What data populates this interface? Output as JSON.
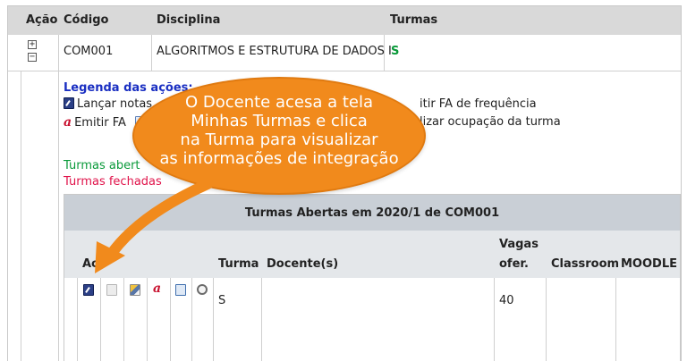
{
  "table": {
    "headers": {
      "acao": "Ação",
      "codigo": "Código",
      "disciplina": "Disciplina",
      "turmas": "Turmas"
    },
    "row": {
      "codigo": "COM001",
      "disciplina": "ALGORITMOS E ESTRUTURA DE DADOS I",
      "turmas": "S"
    },
    "expand_plus": "+",
    "expand_minus": "−"
  },
  "legend": {
    "title": "Legenda das ações:",
    "items": [
      {
        "icon": "edit-icon",
        "label": "Lançar notas"
      },
      {
        "icon": "fa-icon",
        "label": "Emitir FA"
      },
      {
        "icon": "document-icon",
        "label": ""
      },
      {
        "label": "itir FA de frequência"
      },
      {
        "label": "lizar ocupação da turma"
      }
    ]
  },
  "status": {
    "open_label": "Turmas abert",
    "closed_label": "Turmas fechadas",
    "open_color": "#0a9a3a",
    "closed_color": "#e0134a"
  },
  "inner_table": {
    "title": "Turmas Abertas em 2020/1 de COM001",
    "headers": {
      "acoes": "Ac",
      "turma": "Turma",
      "docente": "Docente(s)",
      "vagas_line1": "Vagas",
      "vagas_line2": "ofer.",
      "classroom": "Classroom",
      "moodle": "MOODLE"
    },
    "row": {
      "turma": "S",
      "docente": "",
      "vagas": "40",
      "classroom": "",
      "moodle": ""
    },
    "action_icons": [
      "edit-icon",
      "report-icon",
      "pencil-icon",
      "fa-icon",
      "clipboard-icon",
      "search-icon"
    ]
  },
  "callout": {
    "lines": [
      "O Docente acesa a tela",
      "Minhas Turmas e clica",
      "na Turma para visualizar",
      "as informações de integração"
    ],
    "color": "#f18a1c"
  }
}
